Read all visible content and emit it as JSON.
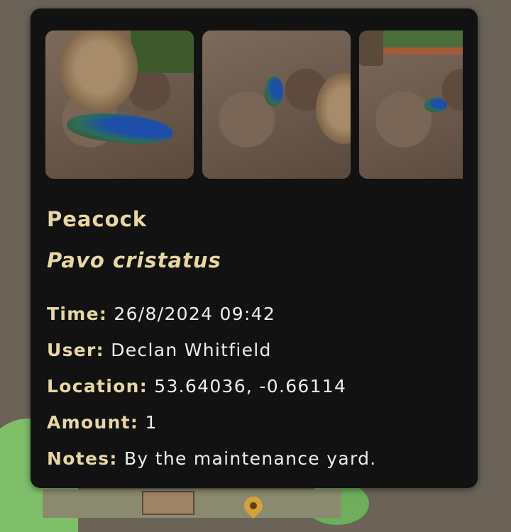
{
  "observation": {
    "common_name": "Peacock",
    "scientific_name": "Pavo cristatus",
    "photos": [
      {
        "subject": "peacock-beside-tree-stump"
      },
      {
        "subject": "peacock-on-leaf-litter"
      },
      {
        "subject": "peacock-near-fence"
      }
    ],
    "fields": [
      {
        "label": "Time:",
        "value": "26/8/2024 09:42"
      },
      {
        "label": "User:",
        "value": "Declan Whitfield"
      },
      {
        "label": "Location:",
        "value": "53.64036, -0.66114"
      },
      {
        "label": "Amount:",
        "value": "1"
      },
      {
        "label": "Notes:",
        "value": "By the maintenance yard."
      }
    ]
  },
  "map": {
    "marker_icon": "map-pin-icon",
    "colors": {
      "land": "#7fbf6a",
      "background": "#6b6358",
      "pin": "#d4a237"
    }
  },
  "theme": {
    "card_background": "#121212",
    "accent": "#e8d7a0",
    "text": "#eeeeee"
  }
}
